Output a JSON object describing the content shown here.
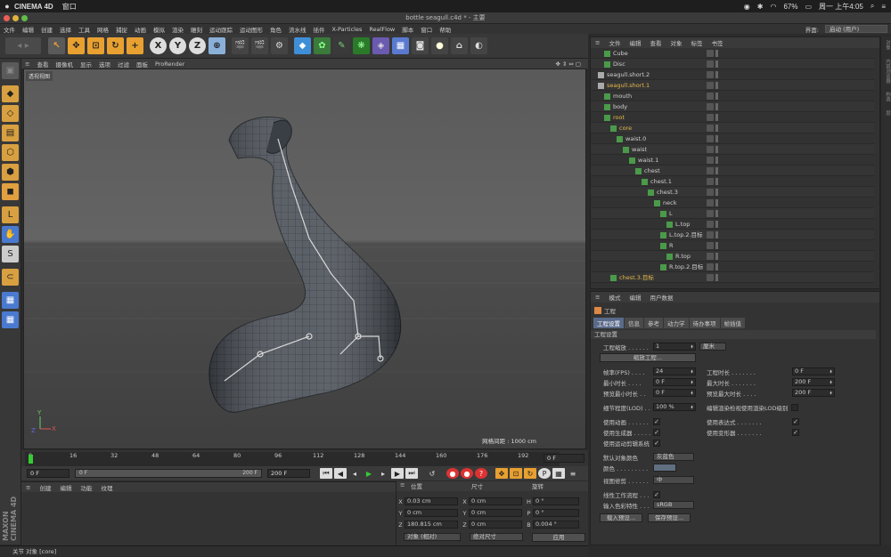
{
  "mac_menubar": {
    "app_name": "CINEMA 4D",
    "window_menu": "窗口",
    "battery": "67%",
    "datetime": "周一 上午4:05"
  },
  "window_title": "bottle seagull.c4d * - 主要",
  "menu": [
    "文件",
    "编辑",
    "创建",
    "选择",
    "工具",
    "网格",
    "捕捉",
    "动画",
    "模拟",
    "渲染",
    "雕刻",
    "运动跟踪",
    "运动图形",
    "角色",
    "流水线",
    "插件",
    "X-Particles",
    "RealFlow",
    "脚本",
    "窗口",
    "帮助"
  ],
  "layout": {
    "label": "界面:",
    "value": "启动 (用户)"
  },
  "viewport": {
    "menu": [
      "查看",
      "摄像机",
      "显示",
      "选项",
      "过滤",
      "面板",
      "ProRender"
    ],
    "view_label": "透视视图",
    "grid_info": "网格间距 : 1000 cm"
  },
  "timeline": {
    "ticks": [
      "0",
      "16",
      "32",
      "48",
      "64",
      "80",
      "96",
      "112",
      "128",
      "144",
      "160",
      "176",
      "192"
    ],
    "frame_field": "0 F",
    "start_field": "0 F",
    "range_start": "0 F",
    "range_end": "200 F",
    "end_field": "200 F"
  },
  "material_menu": [
    "创建",
    "编辑",
    "功能",
    "纹理"
  ],
  "coords": {
    "headers": [
      "位置",
      "尺寸",
      "旋转"
    ],
    "rows": [
      {
        "axis": "X",
        "pos": "0.03 cm",
        "saxis": "X",
        "size": "0 cm",
        "raxis": "H",
        "rot": "0 °"
      },
      {
        "axis": "Y",
        "pos": "0 cm",
        "saxis": "Y",
        "size": "0 cm",
        "raxis": "P",
        "rot": "0 °"
      },
      {
        "axis": "Z",
        "pos": "180.815 cm",
        "saxis": "Z",
        "size": "0 cm",
        "raxis": "B",
        "rot": "0.004 °"
      }
    ],
    "mode1": "对象 (相对)",
    "mode2": "绝对尺寸",
    "apply": "应用"
  },
  "status_text": "关节 对象 [core]",
  "object_manager": {
    "menu": [
      "文件",
      "编辑",
      "查看",
      "对象",
      "标签",
      "书签"
    ],
    "items": [
      {
        "name": "Cube",
        "indent": 1,
        "color": "#cfcfcf"
      },
      {
        "name": "Disc",
        "indent": 1,
        "color": "#cfcfcf"
      },
      {
        "name": "seagull.short.2",
        "indent": 0,
        "color": "#cfcfcf"
      },
      {
        "name": "seagull.short.1",
        "indent": 0,
        "color": "#e5b84a"
      },
      {
        "name": "mouth",
        "indent": 1,
        "color": "#cfcfcf"
      },
      {
        "name": "body",
        "indent": 1,
        "color": "#cfcfcf"
      },
      {
        "name": "root",
        "indent": 1,
        "color": "#e5b84a"
      },
      {
        "name": "core",
        "indent": 2,
        "color": "#e5b84a"
      },
      {
        "name": "waist.0",
        "indent": 3,
        "color": "#cfcfcf"
      },
      {
        "name": "waist",
        "indent": 4,
        "color": "#cfcfcf"
      },
      {
        "name": "waist.1",
        "indent": 5,
        "color": "#cfcfcf"
      },
      {
        "name": "chest",
        "indent": 6,
        "color": "#cfcfcf"
      },
      {
        "name": "chest.1",
        "indent": 7,
        "color": "#cfcfcf"
      },
      {
        "name": "chest.3",
        "indent": 8,
        "color": "#cfcfcf"
      },
      {
        "name": "neck",
        "indent": 9,
        "color": "#cfcfcf"
      },
      {
        "name": "L",
        "indent": 10,
        "color": "#cfcfcf"
      },
      {
        "name": "L.top",
        "indent": 11,
        "color": "#cfcfcf"
      },
      {
        "name": "L.top.2.目标",
        "indent": 10,
        "color": "#cfcfcf"
      },
      {
        "name": "R",
        "indent": 10,
        "color": "#cfcfcf"
      },
      {
        "name": "R.top",
        "indent": 11,
        "color": "#cfcfcf"
      },
      {
        "name": "R.top.2.目标",
        "indent": 10,
        "color": "#cfcfcf"
      },
      {
        "name": "chest.3.目标",
        "indent": 2,
        "color": "#e5b84a"
      }
    ]
  },
  "attribute_manager": {
    "menu": [
      "模式",
      "编辑",
      "用户数据"
    ],
    "title": "工程",
    "tabs": [
      "工程设置",
      "信息",
      "参考",
      "动力学",
      "待办事项",
      "帧插值"
    ],
    "section": "工程设置",
    "scale_label": "工程缩放 . . . . . .",
    "scale_value": "1",
    "scale_unit": "厘米",
    "scale_button": "缩放工程...",
    "fps_label": "帧率(FPS) . . . .",
    "fps_value": "24",
    "duration_label": "工程时长 . . . . . . .",
    "duration_value": "0 F",
    "min_label": "最小时长 . . . .",
    "min_value": "0 F",
    "max_label": "最大时长 . . . . . . .",
    "max_value": "200 F",
    "pmin_label": "预览最小时长 . .",
    "pmin_value": "0 F",
    "pmax_label": "预览最大时长 . . . .",
    "pmax_value": "200 F",
    "lod_label": "细节程度(LOD) . .",
    "lod_value": "100 %",
    "lod_render_label": "编辑渲染检视使用渲染LOD级别",
    "use_anim": "使用动画 . . . . . .",
    "use_expr": "使用表达式 . . . . . . .",
    "use_gen": "使用生成器 . . . . .",
    "use_deform": "使用变形器 . . . . . . .",
    "use_motion": "使用运动剪辑系统",
    "default_color_label": "默认对象颜色",
    "default_color_value": "灰蓝色",
    "color_label": "颜色 . . . . . . . . .",
    "view_clip_label": "视图修剪 . . . . . .",
    "view_clip_value": "中",
    "linear_label": "线性工作流程 . . .",
    "input_profile_label": "输入色彩特性 . . .",
    "input_profile_value": "sRGB",
    "load_preset": "载入预设...",
    "save_preset": "保存预设..."
  },
  "right_strip": [
    "对象",
    "内容浏览器",
    "构造",
    "层"
  ]
}
